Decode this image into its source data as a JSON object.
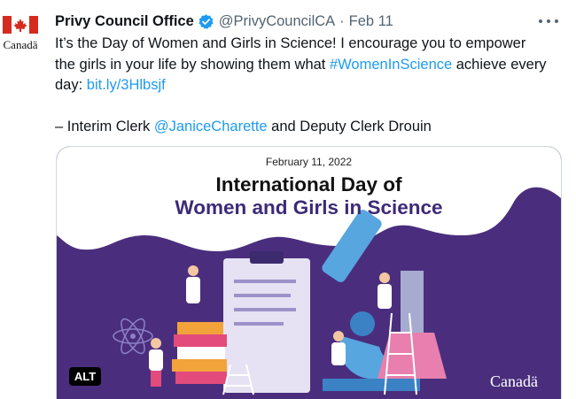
{
  "author": {
    "display_name": "Privy Council Office",
    "handle": "@PrivyCouncilCA",
    "separator": "·",
    "date": "Feb 11",
    "avatar_wordmark": "Canadä",
    "verified": true
  },
  "tweet": {
    "line1": "It’s the Day of Women and Girls in Science! I encourage you to empower",
    "line2_prefix": "the girls in your life by showing them what ",
    "hashtag": "#WomenInScience",
    "line2_suffix": " achieve every",
    "line3_prefix": "day: ",
    "link": "bit.ly/3Hlbsjf",
    "sig_prefix": "– Interim Clerk ",
    "mention": "@JaniceCharette",
    "sig_suffix": " and Deputy Clerk Drouin"
  },
  "media": {
    "date": "February 11, 2022",
    "title_line1": "International Day of",
    "title_line2": "Women and Girls in Science",
    "alt_label": "ALT",
    "wordmark": "Canadä"
  },
  "colors": {
    "link": "#1d9bf0",
    "secondary_text": "#536471",
    "verified_badge": "#1d9bf0",
    "flag_red": "#d52b1e",
    "poster_purple": "#4a2e7d"
  },
  "icons": {
    "avatar": "canada-flag-icon",
    "verified": "verified-badge-icon",
    "more": "more-options-icon"
  }
}
